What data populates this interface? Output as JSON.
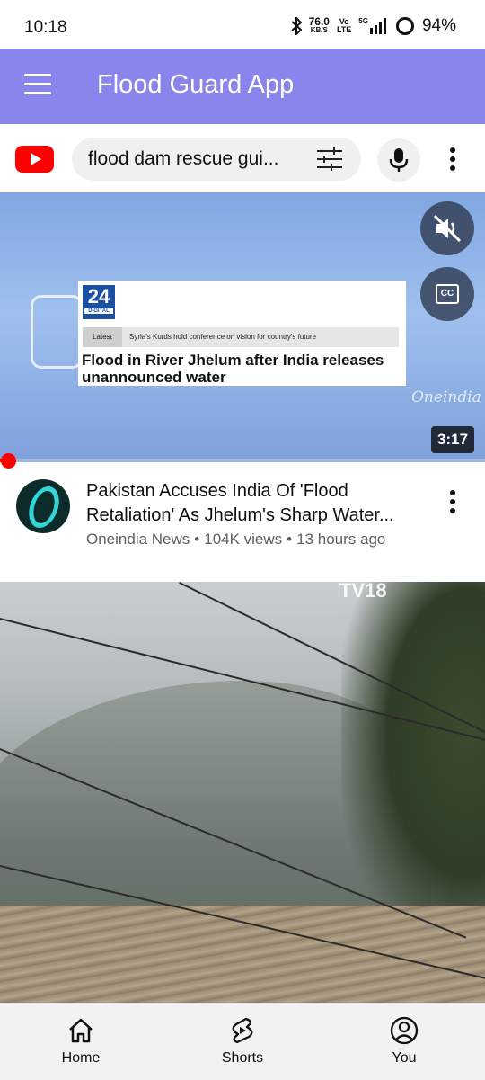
{
  "status_bar": {
    "time": "10:18",
    "net_speed": "76.0",
    "net_speed_unit": "KB/S",
    "volte_top": "Vo",
    "volte_bottom": "LTE",
    "network_type": "5G",
    "battery": "94%"
  },
  "app_bar": {
    "title": "Flood Guard App"
  },
  "search": {
    "query": "flood dam rescue gui..."
  },
  "video_1": {
    "news_logo_number": "24",
    "news_logo_caption": "DIGITAL",
    "ticker_tag": "Latest",
    "ticker_text": "Syria's Kurds hold conference on vision for country's future",
    "headline": "Flood in River Jhelum after India releases unannounced water",
    "watermark": "Oneindia",
    "duration": "3:17",
    "cc_label": "CC",
    "title_line_1": "Pakistan Accuses India Of 'Flood",
    "title_line_2": "Retaliation' As Jhelum's Sharp Water...",
    "channel": "Oneindia News",
    "views": "104K views",
    "age": "13 hours ago",
    "separator": "•"
  },
  "video_2": {
    "watermark": "TV18"
  },
  "bottom_nav": {
    "items": [
      {
        "label": "Home",
        "icon": "home-icon"
      },
      {
        "label": "Shorts",
        "icon": "shorts-icon"
      },
      {
        "label": "You",
        "icon": "account-icon"
      }
    ]
  },
  "colors": {
    "app_bar": "#8a85ec",
    "youtube_red": "#ff0000",
    "meta_gray": "#606060"
  }
}
